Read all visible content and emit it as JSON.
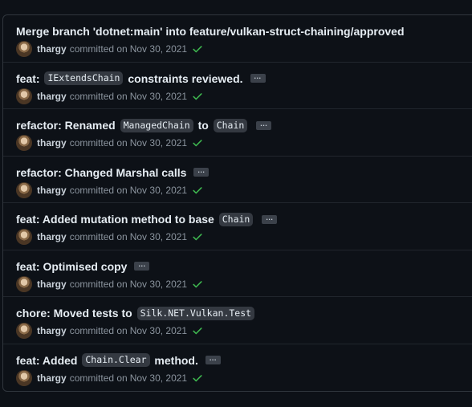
{
  "colors": {
    "background": "#0d1117",
    "border": "#30363d",
    "title_text": "#e6edf3",
    "meta_text": "#8b949e",
    "code_bg": "#343941",
    "check": "#3fb950"
  },
  "commits": [
    {
      "title": [
        {
          "t": "Merge branch 'dotnet:main' into feature/vulkan-struct-chaining/approved"
        }
      ],
      "has_more": false,
      "author": "thargy",
      "verb": "committed on",
      "date": "Nov 30, 2021",
      "status_icon": "check-icon"
    },
    {
      "title": [
        {
          "t": "feat: "
        },
        {
          "code": "IExtendsChain"
        },
        {
          "t": " constraints reviewed."
        }
      ],
      "has_more": true,
      "more_label": "...",
      "author": "thargy",
      "verb": "committed on",
      "date": "Nov 30, 2021",
      "status_icon": "check-icon"
    },
    {
      "title": [
        {
          "t": "refactor: Renamed "
        },
        {
          "code": "ManagedChain"
        },
        {
          "t": " to "
        },
        {
          "code": "Chain"
        }
      ],
      "has_more": true,
      "more_label": "...",
      "author": "thargy",
      "verb": "committed on",
      "date": "Nov 30, 2021",
      "status_icon": "check-icon"
    },
    {
      "title": [
        {
          "t": "refactor: Changed Marshal calls"
        }
      ],
      "has_more": true,
      "more_label": "...",
      "author": "thargy",
      "verb": "committed on",
      "date": "Nov 30, 2021",
      "status_icon": "check-icon"
    },
    {
      "title": [
        {
          "t": "feat: Added mutation method to base "
        },
        {
          "code": "Chain"
        }
      ],
      "has_more": true,
      "more_label": "...",
      "author": "thargy",
      "verb": "committed on",
      "date": "Nov 30, 2021",
      "status_icon": "check-icon"
    },
    {
      "title": [
        {
          "t": "feat: Optimised copy"
        }
      ],
      "has_more": true,
      "more_label": "...",
      "author": "thargy",
      "verb": "committed on",
      "date": "Nov 30, 2021",
      "status_icon": "check-icon"
    },
    {
      "title": [
        {
          "t": "chore: Moved tests to "
        },
        {
          "code": "Silk.NET.Vulkan.Test"
        }
      ],
      "has_more": false,
      "author": "thargy",
      "verb": "committed on",
      "date": "Nov 30, 2021",
      "status_icon": "check-icon"
    },
    {
      "title": [
        {
          "t": "feat: Added "
        },
        {
          "code": "Chain.Clear"
        },
        {
          "t": " method."
        }
      ],
      "has_more": true,
      "more_label": "...",
      "author": "thargy",
      "verb": "committed on",
      "date": "Nov 30, 2021",
      "status_icon": "check-icon"
    }
  ]
}
